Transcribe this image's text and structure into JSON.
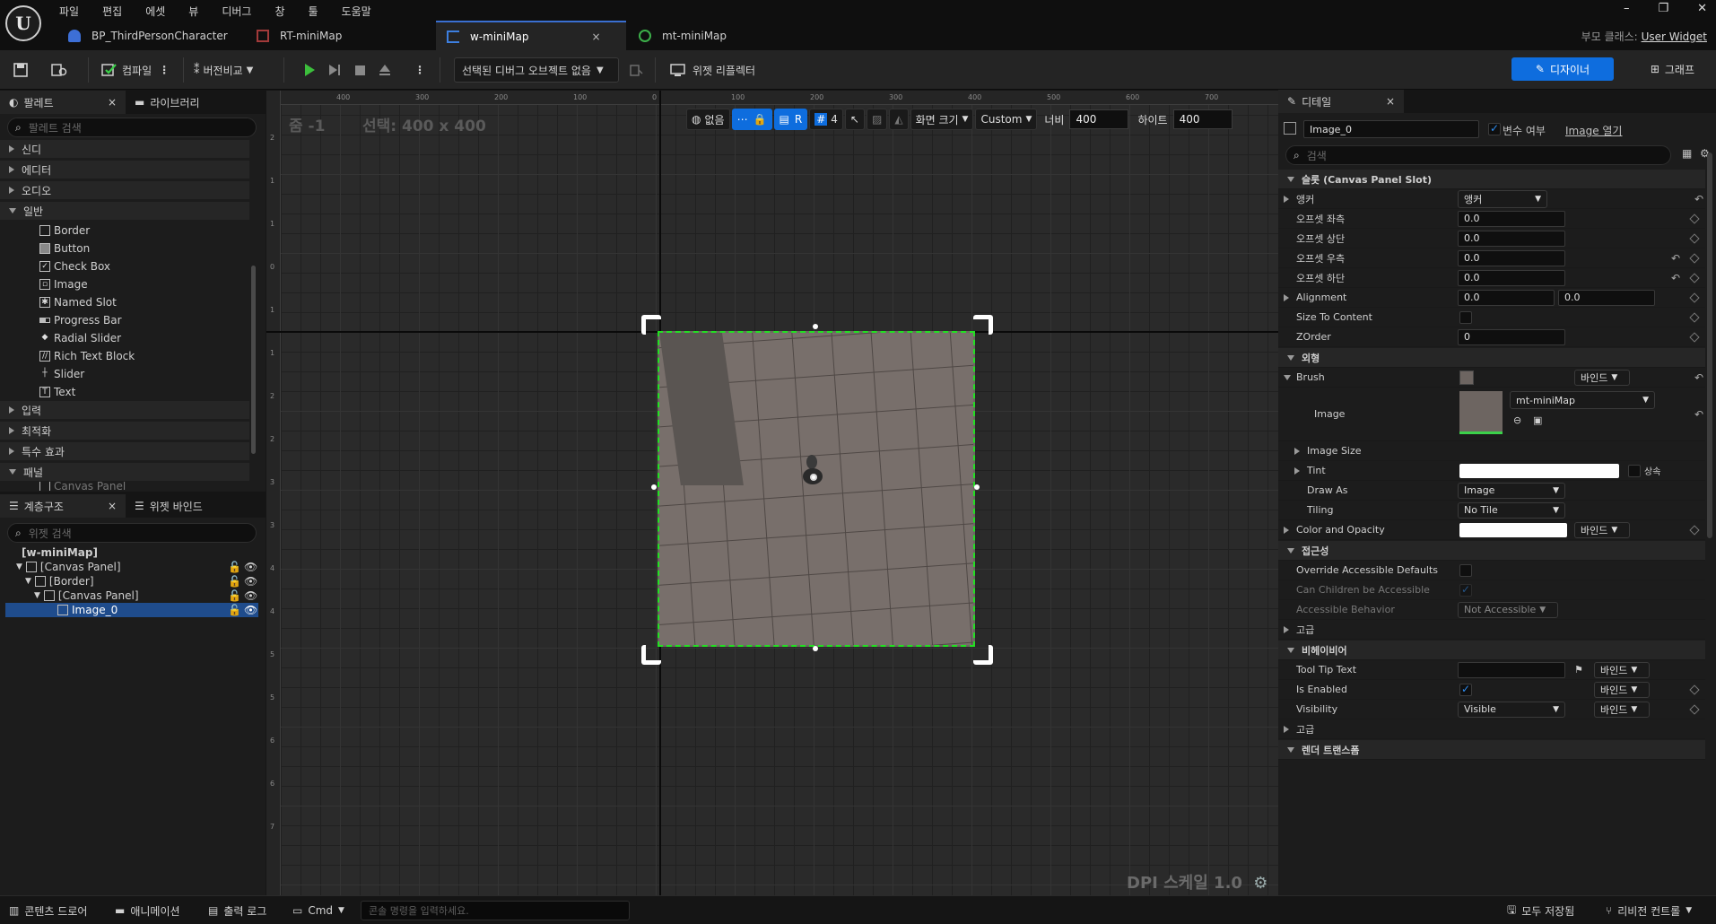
{
  "menu": [
    "파일",
    "편집",
    "에셋",
    "뷰",
    "디버그",
    "창",
    "툴",
    "도움말"
  ],
  "tabs": [
    {
      "label": "BP_ThirdPersonCharacter"
    },
    {
      "label": "RT-miniMap"
    },
    {
      "label": "w-miniMap",
      "close": "×"
    },
    {
      "label": "mt-miniMap"
    }
  ],
  "window_controls": {
    "min": "–",
    "restore": "❐",
    "close": "✕"
  },
  "parent_class": {
    "label": "부모 클래스:",
    "value": "User Widget"
  },
  "toolbar": {
    "compile": "컴파일",
    "diff": "버전비교",
    "debug_object": "선택된 디버그 오브젝트 없음",
    "widget_reflector": "위젯 리플렉터",
    "designer": "디자이너",
    "graph": "그래프"
  },
  "palette": {
    "tab_palette": "팔레트",
    "tab_library": "라이브러리",
    "search_placeholder": "팔레트 검색",
    "categories": [
      "신디",
      "에디터",
      "오디오",
      "일반"
    ],
    "common_items": [
      "Border",
      "Button",
      "Check Box",
      "Image",
      "Named Slot",
      "Progress Bar",
      "Radial Slider",
      "Rich Text Block",
      "Slider",
      "Text"
    ],
    "more_categories": [
      "입력",
      "최적화",
      "특수 효과",
      "패널"
    ],
    "partial": "Canvas Panel"
  },
  "hierarchy": {
    "tab_hierarchy": "계층구조",
    "tab_bindings": "위젯 바인드",
    "search_placeholder": "위젯 검색",
    "root": "[w-miniMap]",
    "items": [
      "[Canvas Panel]",
      "[Border]",
      "[Canvas Panel]",
      "Image_0"
    ]
  },
  "viewport": {
    "zoom": "줌 -1",
    "selection": "선택: 400 x 400",
    "localize": "없음",
    "r_label": "R",
    "grid_snap": "4",
    "screen_size": "화면 크기",
    "size_mode": "Custom",
    "width_label": "너비",
    "width": "400",
    "height_label": "하이트",
    "height": "400",
    "dpi": "DPI 스케일 1.0",
    "ruler_top": [
      "400",
      "300",
      "200",
      "100",
      "0",
      "100",
      "200",
      "300",
      "400",
      "500",
      "600",
      "700"
    ],
    "ruler_left": [
      "2",
      "1",
      "1",
      "0",
      "1",
      "1",
      "2",
      "2",
      "3",
      "3",
      "4",
      "4",
      "5",
      "5",
      "6",
      "6",
      "7"
    ]
  },
  "details": {
    "tab": "디테일",
    "name": "Image_0",
    "is_variable": "변수 여부",
    "open_image": "Image 열기",
    "search_placeholder": "검색",
    "slot_section": "슬롯 (Canvas Panel Slot)",
    "anchor_label": "앵커",
    "anchor_value": "앵커",
    "offset_left": "오프셋 좌측",
    "offset_top": "오프셋 상단",
    "offset_right": "오프셋 우측",
    "offset_bottom": "오프셋 하단",
    "zero": "0.0",
    "alignment": "Alignment",
    "size_to_content": "Size To Content",
    "zorder": "ZOrder",
    "zorder_value": "0",
    "appearance": "외형",
    "brush": "Brush",
    "bind": "바인드",
    "image": "Image",
    "image_asset": "mt-miniMap",
    "image_size": "Image Size",
    "tint": "Tint",
    "inherit": "상속",
    "draw_as": "Draw As",
    "draw_as_value": "Image",
    "tiling": "Tiling",
    "tiling_value": "No Tile",
    "color_opacity": "Color and Opacity",
    "accessibility": "접근성",
    "override_access": "Override Accessible Defaults",
    "children_access": "Can Children be Accessible",
    "access_behavior": "Accessible Behavior",
    "access_behavior_value": "Not Accessible",
    "advanced": "고급",
    "behavior": "비헤이비어",
    "tooltip": "Tool Tip Text",
    "is_enabled": "Is Enabled",
    "visibility": "Visibility",
    "visibility_value": "Visible",
    "render_transform": "렌더 트랜스폼"
  },
  "bottom": {
    "content_drawer": "콘텐츠 드로어",
    "animation": "애니메이션",
    "output_log": "출력 로그",
    "cmd": "Cmd",
    "cmd_placeholder": "콘솔 명령을 입력하세요.",
    "save_all": "모두 저장됨",
    "revision": "리비전 컨트롤"
  },
  "colors": {
    "accent": "#0e6dde",
    "selection": "#22e022",
    "bg": "#151515"
  }
}
